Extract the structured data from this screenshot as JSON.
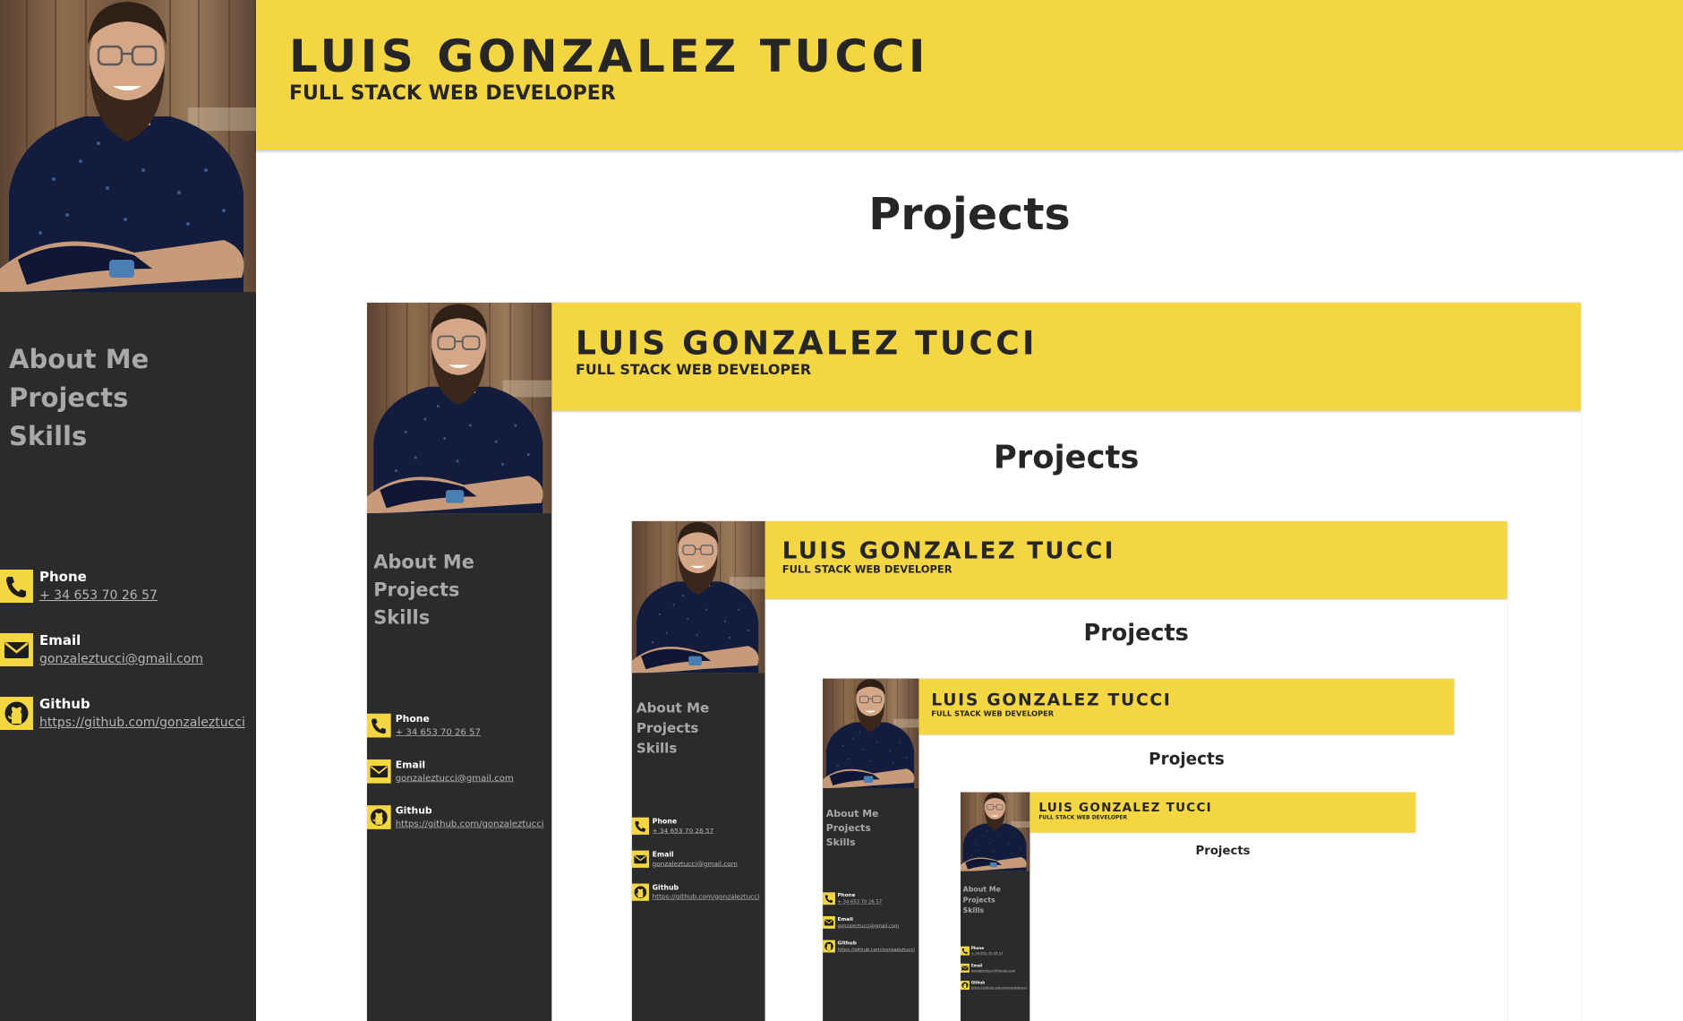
{
  "profile": {
    "name": "LUIS GONZALEZ TUCCI",
    "role": "FULL STACK WEB DEVELOPER",
    "photo_alt": "profile photo"
  },
  "nav": {
    "items": [
      {
        "label": "About Me"
      },
      {
        "label": "Projects"
      },
      {
        "label": "Skills"
      }
    ]
  },
  "contacts": [
    {
      "icon": "phone-icon",
      "label": "Phone",
      "value": "+ 34 653 70 26 57"
    },
    {
      "icon": "email-icon",
      "label": "Email",
      "value": "gonzaleztucci@gmail.com"
    },
    {
      "icon": "github-icon",
      "label": "Github",
      "value": "https://github.com/gonzaleztucci"
    }
  ],
  "main": {
    "section_title": "Projects"
  },
  "colors": {
    "accent": "#f4d643",
    "sidebar": "#292b2c",
    "nav_text": "#a9a9a9",
    "text_dark": "#262626"
  }
}
